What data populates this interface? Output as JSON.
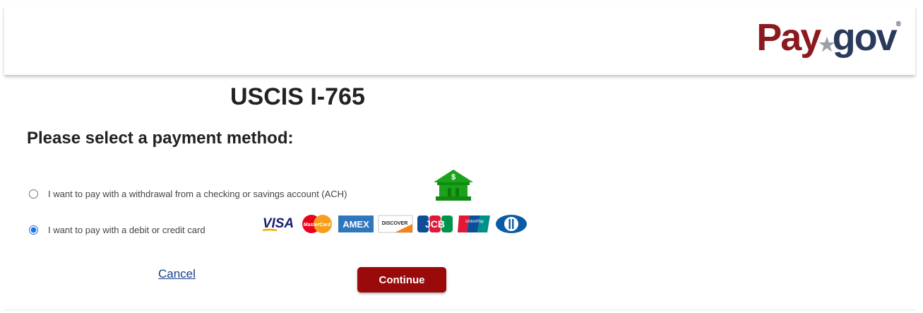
{
  "logo": {
    "pay": "Pay",
    "gov": "gov",
    "star": "★",
    "reg": "®"
  },
  "page": {
    "title": "USCIS I-765",
    "subtitle": "Please select a payment method:"
  },
  "payment_options": [
    {
      "label": "I want to pay with a withdrawal from a checking or savings account (ACH)",
      "selected": false
    },
    {
      "label": "I want to pay with a debit or credit card",
      "selected": true
    }
  ],
  "bank_icon": {
    "symbol": "$"
  },
  "card_logos": {
    "visa": "VISA",
    "mastercard": "MasterCard",
    "amex": "AMEX",
    "discover": "DISCOVER",
    "jcb": "JCB",
    "unionpay": "UnionPay",
    "diners": "D"
  },
  "actions": {
    "cancel": "Cancel",
    "continue": "Continue"
  },
  "colors": {
    "brand_red": "#9b0a0a",
    "brand_navy": "#2b3a5c",
    "bank_green": "#1aa31a",
    "link": "#1a3d8c"
  }
}
